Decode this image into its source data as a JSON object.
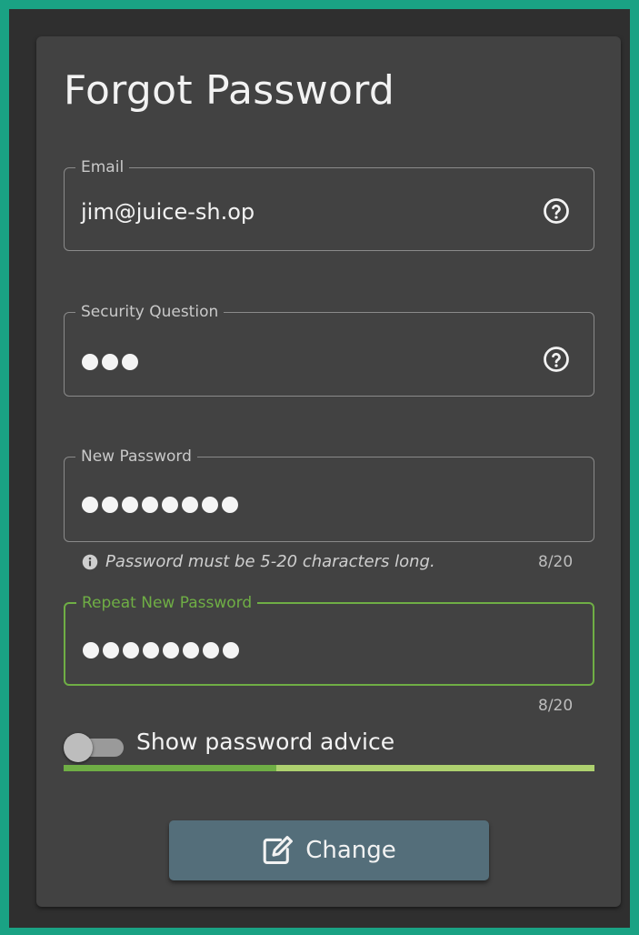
{
  "form": {
    "title": "Forgot Password",
    "email": {
      "label": "Email",
      "value": "jim@juice-sh.op",
      "help_icon": "help-circle-icon"
    },
    "security_question": {
      "label": "Security Question",
      "masked_length": 3,
      "help_icon": "help-circle-icon"
    },
    "new_password": {
      "label": "New Password",
      "masked_length": 8,
      "hint": "Password must be 5-20 characters long.",
      "hint_icon": "info-icon",
      "counter": "8/20"
    },
    "repeat_password": {
      "label": "Repeat New Password",
      "masked_length": 8,
      "counter": "8/20",
      "state": "focused"
    },
    "advice_toggle": {
      "label": "Show password advice",
      "enabled": false
    },
    "strength_meter": {
      "level": 0.4
    },
    "submit": {
      "label": "Change",
      "icon": "edit-icon"
    }
  },
  "colors": {
    "page_background": "#1aa284",
    "card_background": "#424242",
    "accent_green": "#6fae45",
    "strength_light": "#aed16f",
    "button_background": "#546e7a"
  }
}
